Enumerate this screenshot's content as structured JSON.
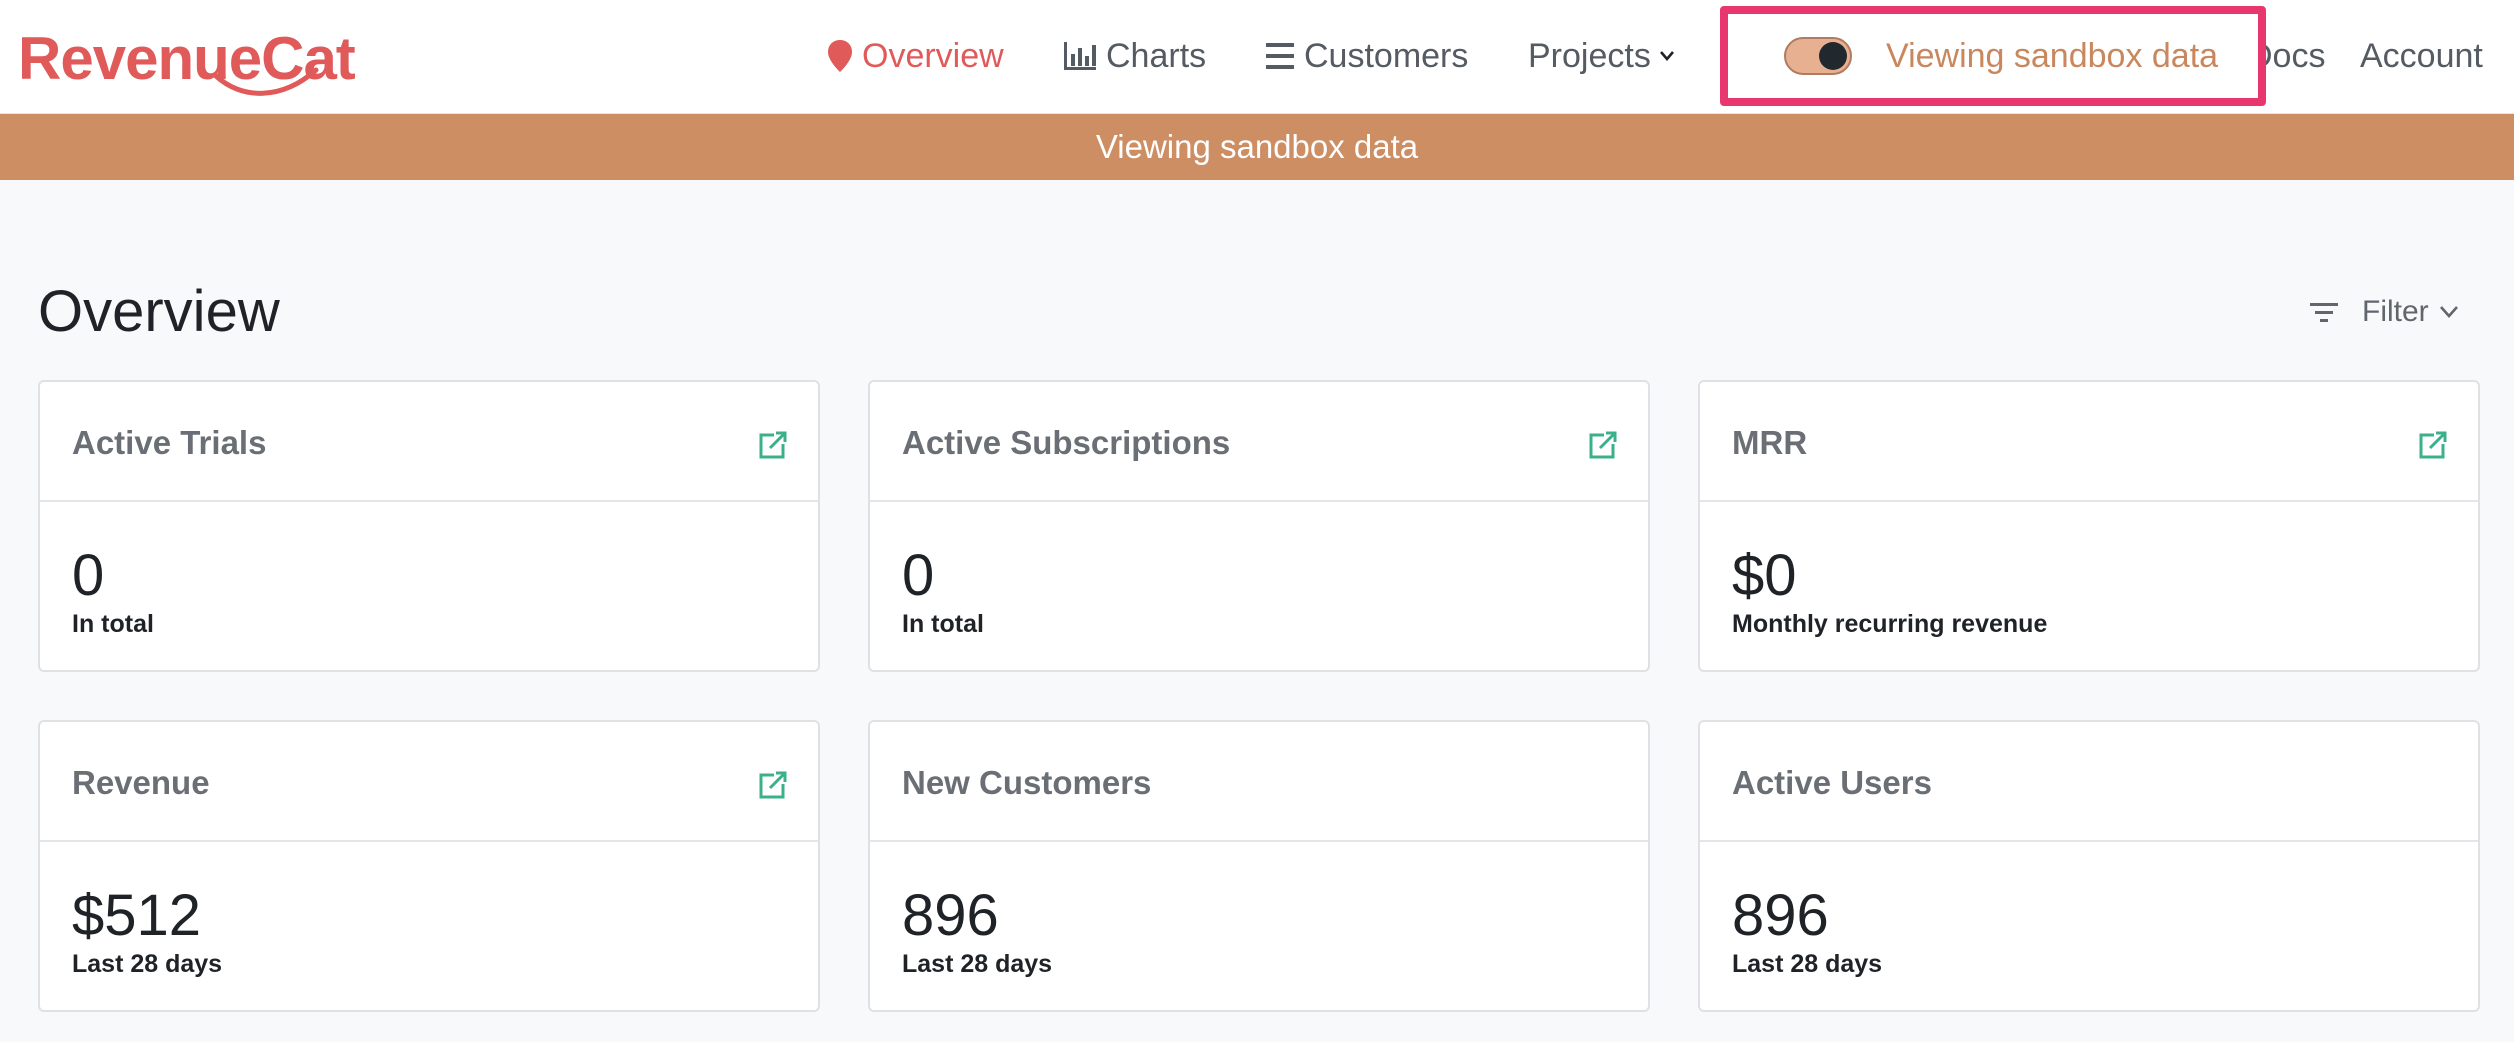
{
  "brand": {
    "name": "RevenueCat",
    "color": "#e05a5a"
  },
  "nav": {
    "overview": {
      "label": "Overview",
      "icon": "map-pin-icon"
    },
    "charts": {
      "label": "Charts",
      "icon": "bar-chart-icon"
    },
    "customers": {
      "label": "Customers",
      "icon": "list-icon"
    },
    "projects": {
      "label": "Projects",
      "icon": "chevron-down-icon"
    },
    "docs": {
      "label": "Docs"
    },
    "account": {
      "label": "Account"
    }
  },
  "sandbox": {
    "label": "Viewing sandbox data",
    "toggle_on": true,
    "highlight_color": "#e8366e"
  },
  "banner": {
    "text": "Viewing sandbox data",
    "color": "#cc8e62"
  },
  "page": {
    "title": "Overview",
    "filter_label": "Filter"
  },
  "cards": [
    {
      "title": "Active Trials",
      "value": "0",
      "subtitle": "In total",
      "has_link": true
    },
    {
      "title": "Active Subscriptions",
      "value": "0",
      "subtitle": "In total",
      "has_link": true
    },
    {
      "title": "MRR",
      "value": "$0",
      "subtitle": "Monthly recurring revenue",
      "has_link": true
    },
    {
      "title": "Revenue",
      "value": "$512",
      "subtitle": "Last 28 days",
      "has_link": true
    },
    {
      "title": "New Customers",
      "value": "896",
      "subtitle": "Last 28 days",
      "has_link": false
    },
    {
      "title": "Active Users",
      "value": "896",
      "subtitle": "Last 28 days",
      "has_link": false
    }
  ]
}
